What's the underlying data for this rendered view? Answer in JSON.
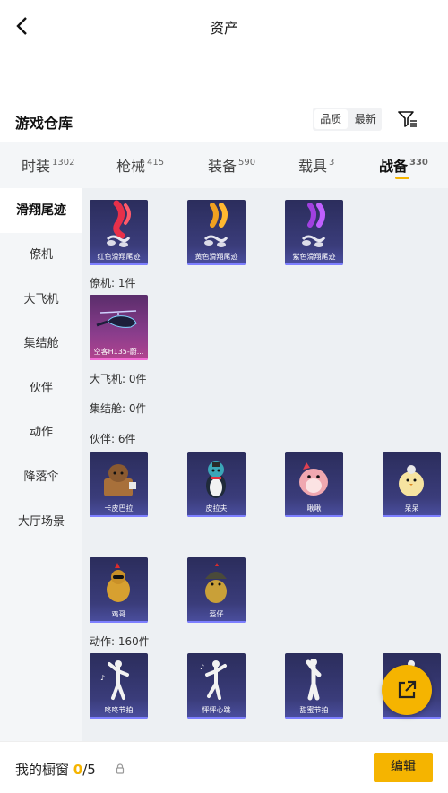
{
  "header": {
    "title": "资产",
    "back_icon": "chevron-left-icon"
  },
  "section": {
    "title": "游戏仓库",
    "sort_options": [
      "品质",
      "最新"
    ],
    "sort_selected": "品质",
    "filter_icon": "filter-icon"
  },
  "tabs": [
    {
      "label": "时装",
      "count": "1302"
    },
    {
      "label": "枪械",
      "count": "415"
    },
    {
      "label": "装备",
      "count": "590"
    },
    {
      "label": "载具",
      "count": "3"
    },
    {
      "label": "战备",
      "count": "330",
      "active": true
    }
  ],
  "sidebar": {
    "items": [
      "滑翔尾迹",
      "僚机",
      "大飞机",
      "集结舱",
      "伙伴",
      "动作",
      "降落伞",
      "大厅场景"
    ],
    "active": "滑翔尾迹"
  },
  "groups": {
    "glide_trails": {
      "items": [
        {
          "name": "红色滑翔尾迹",
          "art": "red-trail",
          "color": "#e8304a"
        },
        {
          "name": "黄色滑翔尾迹",
          "art": "yellow-trail",
          "color": "#f0a020"
        },
        {
          "name": "紫色滑翔尾迹",
          "art": "purple-trail",
          "color": "#a040e0"
        }
      ]
    },
    "wingman": {
      "title": "僚机: 1件",
      "items": [
        {
          "name": "空客H135-蔚...",
          "art": "helicopter"
        }
      ]
    },
    "big_plane": {
      "title": "大飞机: 0件"
    },
    "capsule": {
      "title": "集结舱: 0件"
    },
    "companion": {
      "title": "伙伴: 6件",
      "items": [
        {
          "name": "卡皮巴拉",
          "art": "capybara"
        },
        {
          "name": "皮拉夫",
          "art": "penguin"
        },
        {
          "name": "啾啾",
          "art": "pink-bird"
        },
        {
          "name": "呆呆",
          "art": "chick"
        },
        {
          "name": "鸡哥",
          "art": "rooster"
        },
        {
          "name": "盔仔",
          "art": "helmet-duck"
        }
      ]
    },
    "emote": {
      "title": "动作: 160件",
      "items": [
        {
          "name": "咚咚节拍",
          "art": "dance-1"
        },
        {
          "name": "怦怦心跳",
          "art": "dance-2"
        },
        {
          "name": "甜蜜节拍",
          "art": "dance-3"
        },
        {
          "name": "",
          "art": "dance-4"
        }
      ]
    }
  },
  "fab": {
    "icon": "share-external-icon"
  },
  "bottom": {
    "label": "我的橱窗",
    "count_current": "0",
    "count_total": "/5",
    "lock_icon": "lock-icon",
    "edit_label": "编辑"
  },
  "colors": {
    "accent": "#f5b400",
    "card_bg": "#2b2d5c",
    "panel_bg": "#edf0f3"
  }
}
